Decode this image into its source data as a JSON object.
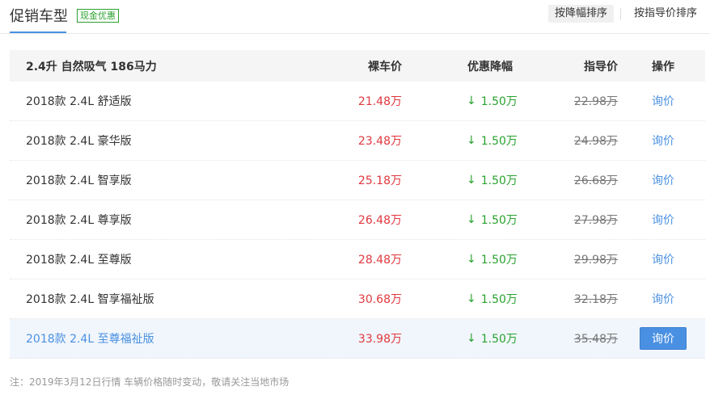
{
  "header": {
    "title": "促销车型",
    "badge": "现金优惠",
    "sort_by_discount": "按降幅排序",
    "sort_by_guide": "按指导价排序"
  },
  "table": {
    "columns": {
      "group": "2.4升 自然吸气 186马力",
      "price": "裸车价",
      "discount": "优惠降幅",
      "guide": "指导价",
      "op": "操作"
    },
    "rows": [
      {
        "name": "2018款 2.4L 舒适版",
        "price": "21.48万",
        "discount": "1.50万",
        "guide": "22.98万",
        "op": "询价"
      },
      {
        "name": "2018款 2.4L 豪华版",
        "price": "23.48万",
        "discount": "1.50万",
        "guide": "24.98万",
        "op": "询价"
      },
      {
        "name": "2018款 2.4L 智享版",
        "price": "25.18万",
        "discount": "1.50万",
        "guide": "26.68万",
        "op": "询价"
      },
      {
        "name": "2018款 2.4L 尊享版",
        "price": "26.48万",
        "discount": "1.50万",
        "guide": "27.98万",
        "op": "询价"
      },
      {
        "name": "2018款 2.4L 至尊版",
        "price": "28.48万",
        "discount": "1.50万",
        "guide": "29.98万",
        "op": "询价"
      },
      {
        "name": "2018款 2.4L 智享福祉版",
        "price": "30.68万",
        "discount": "1.50万",
        "guide": "32.18万",
        "op": "询价"
      },
      {
        "name": "2018款 2.4L 至尊福祉版",
        "price": "33.98万",
        "discount": "1.50万",
        "guide": "35.48万",
        "op": "询价"
      }
    ],
    "arrow_symbol": "↓"
  },
  "note": "注：2019年3月12日行情 车辆价格随时变动，敬请关注当地市场",
  "colors": {
    "accent": "#4a90e2",
    "price": "#e0383e",
    "discount": "#2aa22f"
  }
}
